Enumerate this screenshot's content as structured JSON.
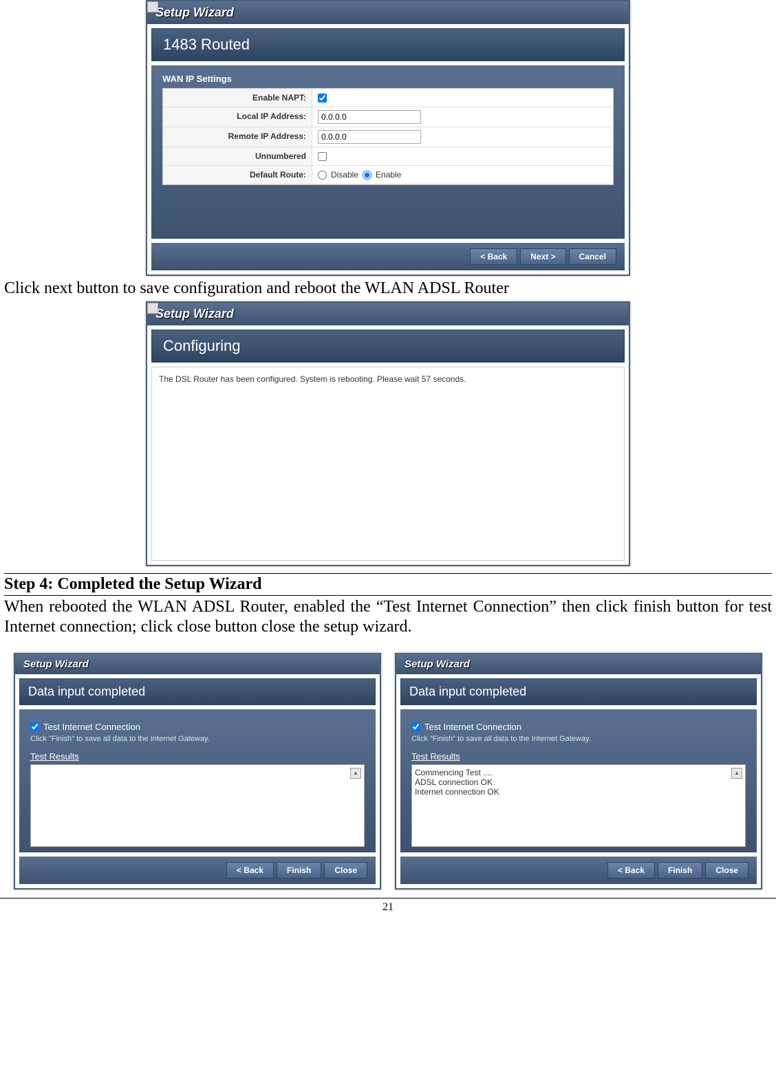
{
  "wizard1": {
    "title": "Setup Wizard",
    "section": "1483 Routed",
    "sectionLabel": "WAN IP Settings",
    "rows": {
      "enableNapt": {
        "label": "Enable NAPT:",
        "checked": true
      },
      "localIp": {
        "label": "Local IP Address:",
        "value": "0.0.0.0"
      },
      "remoteIp": {
        "label": "Remote IP Address:",
        "value": "0.0.0.0"
      },
      "unnumbered": {
        "label": "Unnumbered",
        "checked": false
      },
      "defaultRoute": {
        "label": "Default Route:",
        "disable": "Disable",
        "enable": "Enable"
      }
    },
    "buttons": {
      "back": "< Back",
      "next": "Next >",
      "cancel": "Cancel"
    }
  },
  "bodyText1": "Click next button to save configuration and reboot the WLAN ADSL Router",
  "wizard2": {
    "title": "Setup Wizard",
    "section": "Configuring",
    "message": "The DSL Router has been configured. System is rebooting. Please wait 57 seconds."
  },
  "stepHeading": "Step 4: Completed the Setup Wizard",
  "bodyText2": "When rebooted the WLAN ADSL Router, enabled the “Test Internet Connection” then click finish button for test Internet connection; click close button close the setup wizard.",
  "wizard3": {
    "title": "Setup Wizard",
    "section": "Data input completed",
    "checkboxLabel": "Test Internet Connection",
    "instruction": "Click \"Finish\" to save all data to the Internet Gateway.",
    "testResultsLabel": "Test Results",
    "results": "",
    "buttons": {
      "back": "< Back",
      "finish": "Finish",
      "close": "Close"
    }
  },
  "wizard4": {
    "title": "Setup Wizard",
    "section": "Data input completed",
    "checkboxLabel": "Test Internet Connection",
    "instruction": "Click \"Finish\" to save all data to the Internet Gateway.",
    "testResultsLabel": "Test Results",
    "results": "Commencing Test ....\nADSL connection OK\nInternet connection OK",
    "buttons": {
      "back": "< Back",
      "finish": "Finish",
      "close": "Close"
    }
  },
  "pageNumber": "21"
}
